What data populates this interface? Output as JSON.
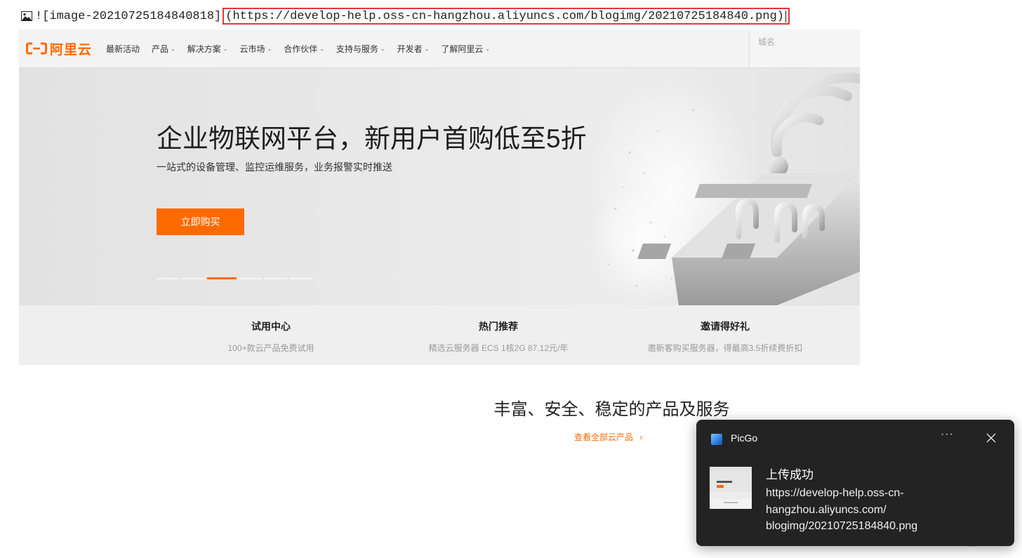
{
  "markdown": {
    "prefix": "![image-20210725184840818]",
    "url_part": "(https://develop-help.oss-cn-hangzhou.aliyuncs.com/blogimg/20210725184840.png)"
  },
  "site": {
    "logo_text": "阿里云",
    "nav": [
      {
        "label": "最新活动",
        "has_dropdown": false
      },
      {
        "label": "产品",
        "has_dropdown": true
      },
      {
        "label": "解决方案",
        "has_dropdown": true
      },
      {
        "label": "云市场",
        "has_dropdown": true
      },
      {
        "label": "合作伙伴",
        "has_dropdown": true
      },
      {
        "label": "支持与服务",
        "has_dropdown": true
      },
      {
        "label": "开发者",
        "has_dropdown": true
      },
      {
        "label": "了解阿里云",
        "has_dropdown": true
      }
    ],
    "city_placeholder": "城名",
    "hero": {
      "title": "企业物联网平台，新用户首购低至5折",
      "subtitle": "一站式的设备管理、监控运维服务，业务报警实时推送",
      "button": "立即购买",
      "carousel_count": 6,
      "carousel_active": 3
    },
    "features": [
      {
        "title": "试用中心",
        "desc": "100+款云产品免费试用"
      },
      {
        "title": "热门推荐",
        "desc": "精选云服务器 ECS 1核2G 87.12元/年"
      },
      {
        "title": "邀请得好礼",
        "desc": "邀新客购买服务器，得最高3.5折续费折扣"
      }
    ],
    "section_title": "丰富、安全、稳定的产品及服务",
    "view_all": "查看全部云产品"
  },
  "toast": {
    "app_name": "PicGo",
    "more_label": "···",
    "title": "上传成功",
    "lines": [
      "https://develop-help.oss-cn-",
      "hangzhou.aliyuncs.com/",
      "blogimg/20210725184840.png"
    ]
  },
  "colors": {
    "accent": "#ff6a00",
    "highlight_border": "#e0383e",
    "toast_bg": "#232323"
  }
}
